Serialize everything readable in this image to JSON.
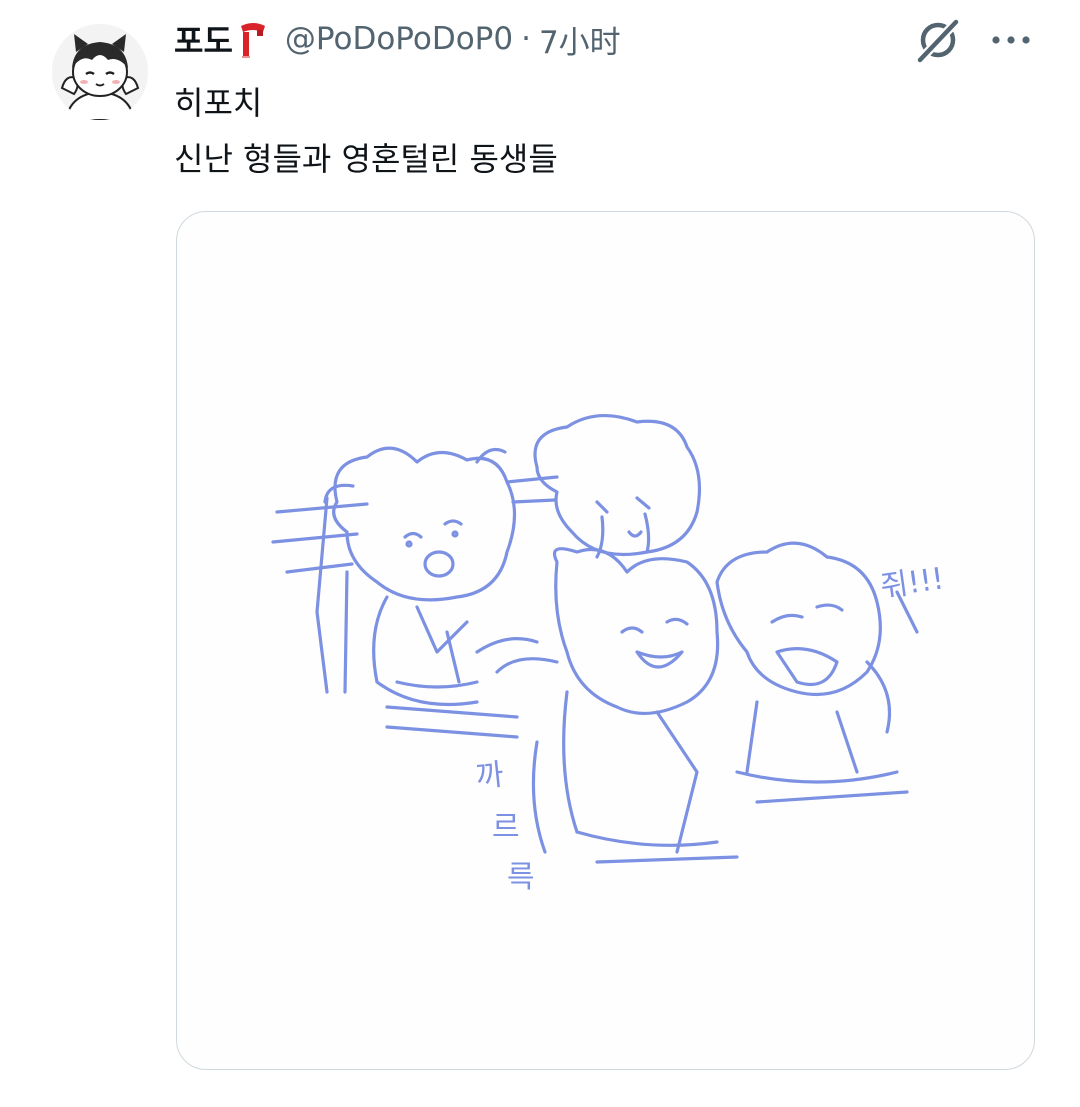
{
  "tweet": {
    "author": {
      "display_name": "포도",
      "name_emoji_icon": "red-scarf-icon",
      "handle": "@PoDoPoDoP0",
      "avatar_icon": "cartoon-cat-boy-avatar"
    },
    "separator": "·",
    "time": "7小时",
    "actions": {
      "grok_icon": "grok-icon",
      "more_icon": "more-horizontal-icon"
    },
    "text_lines": [
      "히포치",
      "신난 형들과 영혼털린 동생들"
    ],
    "media": {
      "type": "image",
      "description_icon": "blue-sketch-illustration",
      "sketch_texts": [
        "쥐!!!",
        "까르륵"
      ]
    }
  },
  "colors": {
    "text_primary": "#0f1419",
    "text_secondary": "#536471",
    "card_border": "#cfd9de",
    "sketch_blue": "#6f86e0",
    "scarf_red": "#d8232a"
  }
}
